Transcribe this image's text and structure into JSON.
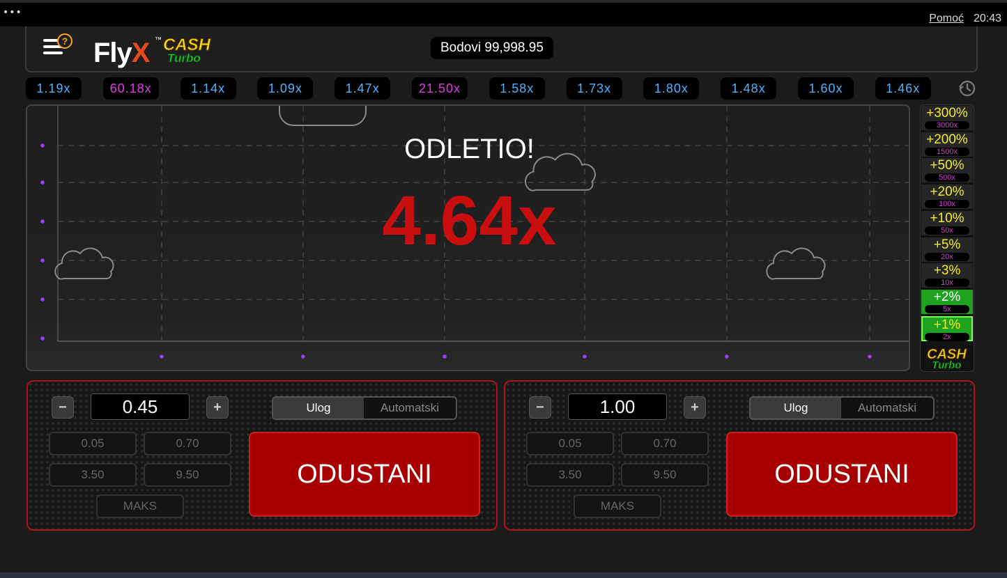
{
  "topbar": {
    "menu_dots": "•••",
    "help_label": "Pomoć",
    "time": "20:43"
  },
  "header": {
    "logo_fly": "Fly",
    "logo_x": "X",
    "logo_tm": "™",
    "logo_cash": "CASH",
    "logo_turbo": "Turbo",
    "balance": "Bodovi 99,998.95"
  },
  "history": [
    {
      "value": "1.19x",
      "color": "#4fb3ff"
    },
    {
      "value": "60.18x",
      "color": "#e63ae6"
    },
    {
      "value": "1.14x",
      "color": "#4fb3ff"
    },
    {
      "value": "1.09x",
      "color": "#4fb3ff"
    },
    {
      "value": "1.47x",
      "color": "#4fb3ff"
    },
    {
      "value": "21.50x",
      "color": "#e63ae6"
    },
    {
      "value": "1.58x",
      "color": "#4fb3ff"
    },
    {
      "value": "1.73x",
      "color": "#4fb3ff"
    },
    {
      "value": "1.80x",
      "color": "#4fb3ff"
    },
    {
      "value": "1.48x",
      "color": "#4fb3ff"
    },
    {
      "value": "1.60x",
      "color": "#4fb3ff"
    },
    {
      "value": "1.46x",
      "color": "#4fb3ff"
    }
  ],
  "game": {
    "status_text": "ODLETIO!",
    "multiplier": "4.64x",
    "multiplier_color": "#c80e0e"
  },
  "ladder": [
    {
      "pct": "+300%",
      "mult": "3000x",
      "state": "off"
    },
    {
      "pct": "+200%",
      "mult": "1500x",
      "state": "off"
    },
    {
      "pct": "+50%",
      "mult": "500x",
      "state": "off"
    },
    {
      "pct": "+20%",
      "mult": "100x",
      "state": "off"
    },
    {
      "pct": "+10%",
      "mult": "50x",
      "state": "off"
    },
    {
      "pct": "+5%",
      "mult": "20x",
      "state": "off"
    },
    {
      "pct": "+3%",
      "mult": "10x",
      "state": "off"
    },
    {
      "pct": "+2%",
      "mult": "5x",
      "state": "on"
    },
    {
      "pct": "+1%",
      "mult": "2x",
      "state": "active"
    }
  ],
  "ladder_logo": {
    "cash": "CASH",
    "turbo": "Turbo"
  },
  "panels": [
    {
      "minus": "−",
      "plus": "+",
      "bet": "0.45",
      "tab_bet": "Ulog",
      "tab_auto": "Automatski",
      "quick": [
        "0.05",
        "0.70",
        "3.50",
        "9.50"
      ],
      "max": "MAKS",
      "action": "ODUSTANI"
    },
    {
      "minus": "−",
      "plus": "+",
      "bet": "1.00",
      "tab_bet": "Ulog",
      "tab_auto": "Automatski",
      "quick": [
        "0.05",
        "0.70",
        "3.50",
        "9.50"
      ],
      "max": "MAKS",
      "action": "ODUSTANI"
    }
  ],
  "colors": {
    "accent_red": "#b0141a",
    "ladder_yellow": "#f4ec2a",
    "ladder_green": "#1fa21f",
    "grid_dot": "#9b3cff"
  }
}
